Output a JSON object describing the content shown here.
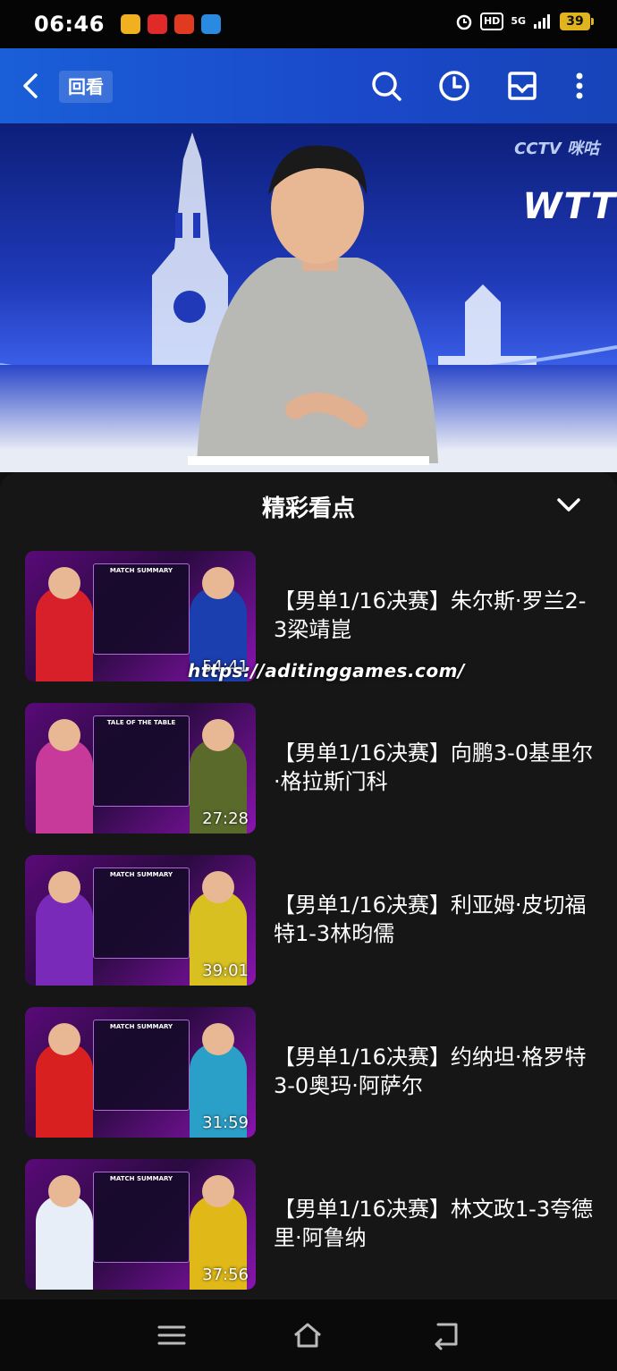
{
  "status_bar": {
    "time": "06:46",
    "hd": "HD",
    "network": "5G",
    "battery": "39"
  },
  "top_bar": {
    "replay_label": "回看"
  },
  "video": {
    "broadcaster": "CCTV 咪咕",
    "event_logo": "WTT"
  },
  "panel": {
    "title": "精彩看点",
    "items": [
      {
        "title": "【男单1/16决赛】朱尔斯·罗兰2-3梁靖崑",
        "duration": "54:41",
        "board": "MATCH SUMMARY",
        "p1_color": "#d8202a",
        "p2_color": "#1c3fb0"
      },
      {
        "title": "【男单1/16决赛】向鹏3-0基里尔·格拉斯门科",
        "duration": "27:28",
        "board": "TALE OF THE TABLE",
        "p1_color": "#c83a9a",
        "p2_color": "#5a6a2a"
      },
      {
        "title": "【男单1/16决赛】利亚姆·皮切福特1-3林昀儒",
        "duration": "39:01",
        "board": "MATCH SUMMARY",
        "p1_color": "#7a2ab8",
        "p2_color": "#d8c020"
      },
      {
        "title": "【男单1/16决赛】约纳坦·格罗特3-0奥玛·阿萨尔",
        "duration": "31:59",
        "board": "MATCH SUMMARY",
        "p1_color": "#d82020",
        "p2_color": "#2aa0c8"
      },
      {
        "title": "【男单1/16决赛】林文政1-3夸德里·阿鲁纳",
        "duration": "37:56",
        "board": "MATCH SUMMARY",
        "p1_color": "#e8eef8",
        "p2_color": "#e0b818"
      }
    ]
  },
  "watermark": "https://aditinggames.com/"
}
